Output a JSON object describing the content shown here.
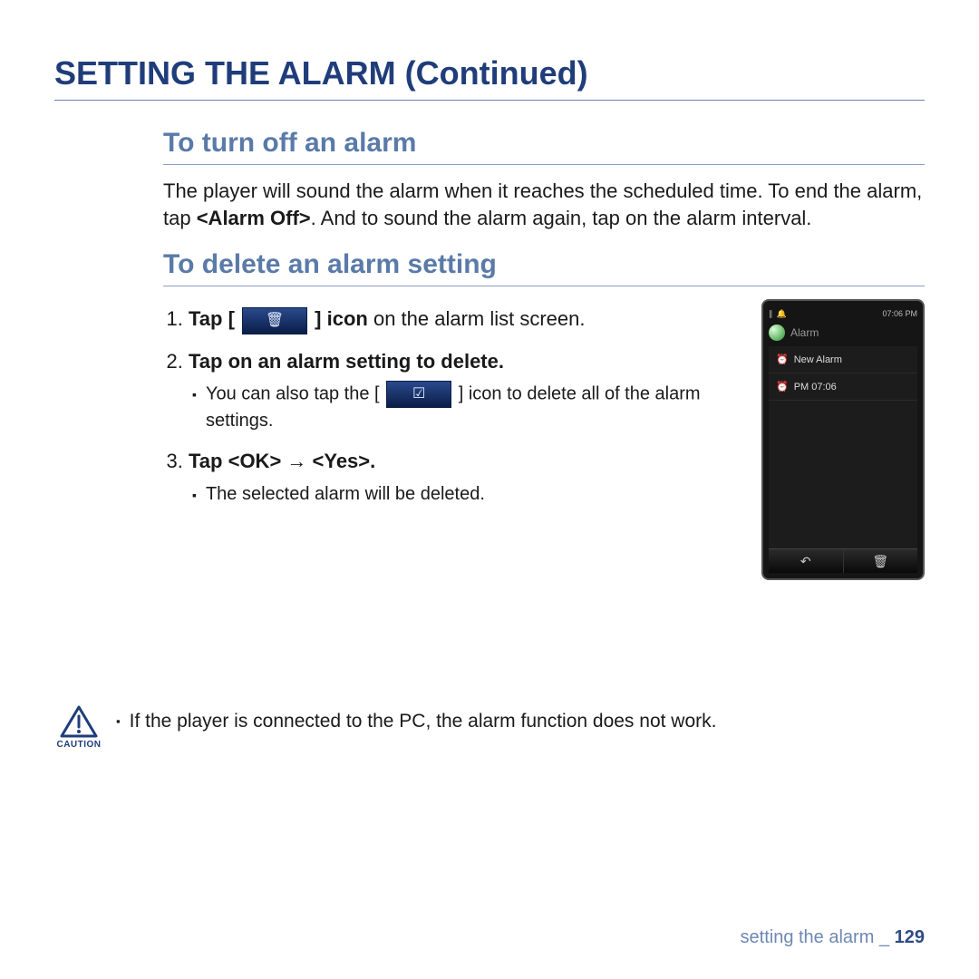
{
  "title": "SETTING THE ALARM (Continued)",
  "section1": {
    "title": "To turn off an alarm",
    "text_parts": {
      "a": "The player will sound the alarm when it reaches the scheduled time. To end the alarm, tap ",
      "bold": "<Alarm Off>",
      "b": ". And to sound the alarm again, tap on the alarm interval."
    }
  },
  "section2": {
    "title": "To delete an alarm setting",
    "step1": {
      "num": "1.",
      "pre": "Tap [",
      "icon_glyph": "🗑",
      "mid_bold": "] icon",
      "post": " on the alarm list screen."
    },
    "step2": {
      "num": "2.",
      "text": "Tap on an alarm setting to delete.",
      "sub_pre": "You can also tap the [",
      "sub_icon_glyph": "☑",
      "sub_post": "] icon to delete all of the alarm settings."
    },
    "step3": {
      "num": "3.",
      "text": "Tap <OK> → <Yes>.",
      "sub": "The selected alarm will be deleted."
    }
  },
  "device": {
    "status_time": "07:06 PM",
    "header": "Alarm",
    "row1": "New Alarm",
    "row2": "PM 07:06",
    "nav_back_glyph": "↶",
    "nav_trash_glyph": "🗑"
  },
  "caution": {
    "label": "CAUTION",
    "text": "If the player is connected to the PC, the alarm function does not work."
  },
  "footer": {
    "section": "setting the alarm",
    "sep": "_",
    "page": "129"
  }
}
